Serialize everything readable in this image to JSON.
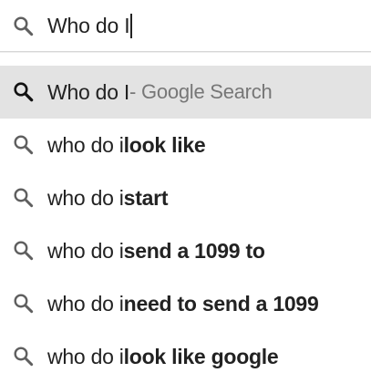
{
  "search": {
    "value": "Who do I",
    "icon": "search-icon"
  },
  "suggestions": [
    {
      "icon": "search-icon",
      "prefix": "Who do I",
      "match": "",
      "suffix": " - Google Search",
      "active": true
    },
    {
      "icon": "search-icon",
      "prefix": "who do i ",
      "match": "look like",
      "suffix": "",
      "active": false
    },
    {
      "icon": "search-icon",
      "prefix": "who do i ",
      "match": "start",
      "suffix": "",
      "active": false
    },
    {
      "icon": "search-icon",
      "prefix": "who do i ",
      "match": "send a 1099 to",
      "suffix": "",
      "active": false
    },
    {
      "icon": "search-icon",
      "prefix": "who do i ",
      "match": "need to send a 1099",
      "suffix": "",
      "active": false
    },
    {
      "icon": "search-icon",
      "prefix": "who do i ",
      "match": "look like google",
      "suffix": "",
      "active": false
    }
  ],
  "colors": {
    "active_row": "#e3e3e3",
    "suffix_text": "#777777",
    "icon": "#5f5f5f"
  }
}
